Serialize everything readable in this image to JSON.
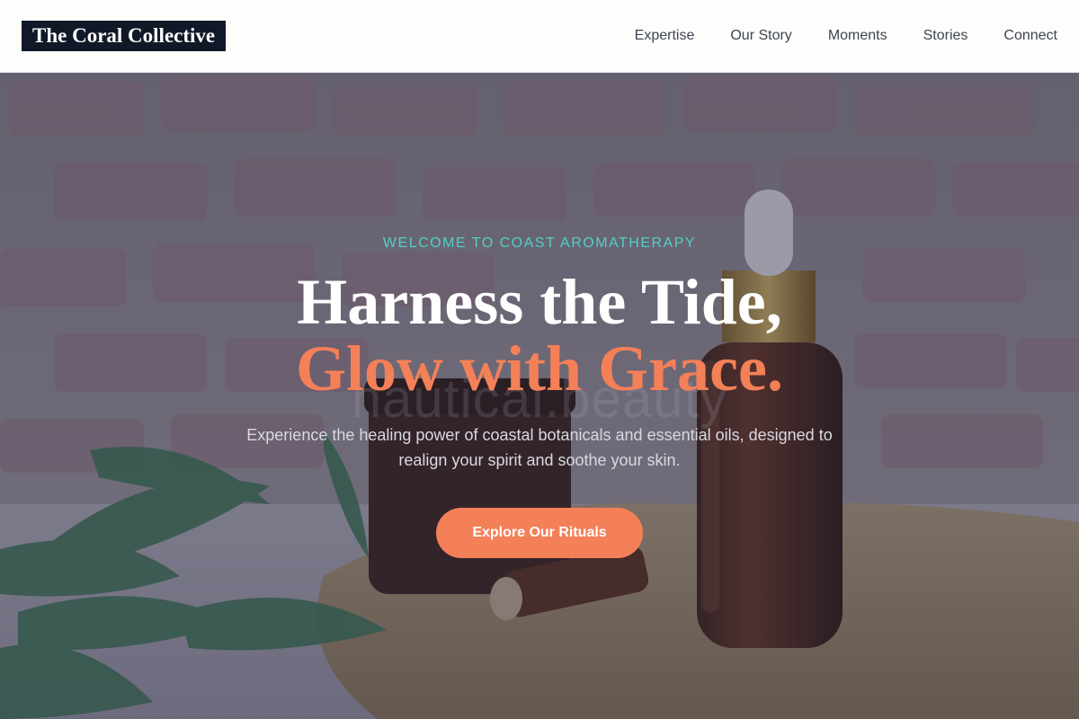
{
  "header": {
    "logo": "The Coral Collective",
    "nav": [
      "Expertise",
      "Our Story",
      "Moments",
      "Stories",
      "Connect"
    ]
  },
  "hero": {
    "eyebrow": "WELCOME TO COAST AROMATHERAPY",
    "title_line1": "Harness the Tide,",
    "title_line2": "Glow with Grace.",
    "watermark": "nautical.beauty",
    "lead": "Experience the healing power of coastal botanicals and essential oils, designed to realign your spirit and soothe your skin.",
    "cta": "Explore Our Rituals"
  },
  "colors": {
    "accent": "#f48058",
    "teal": "#4fd1c5",
    "logo_bg": "#111827"
  }
}
